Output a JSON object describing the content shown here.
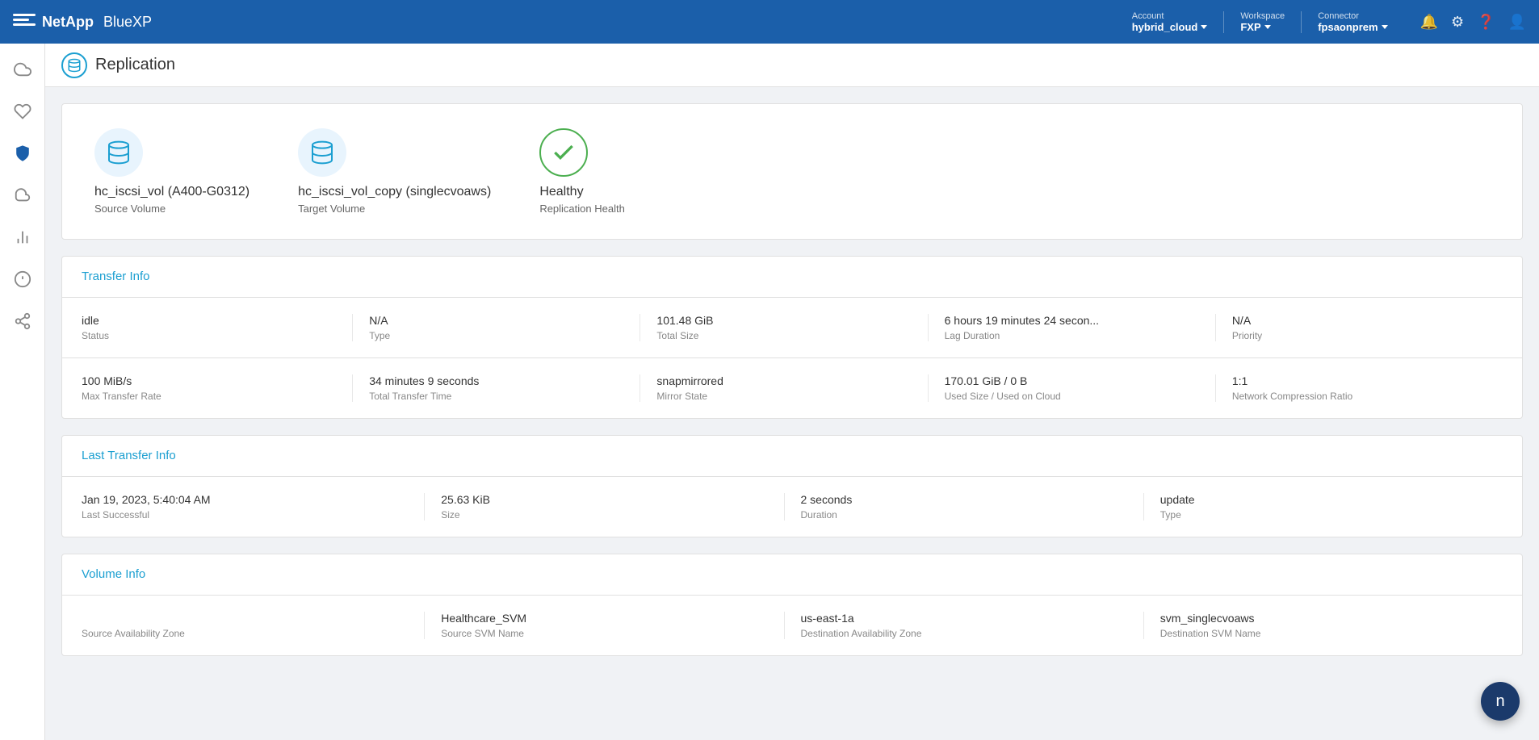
{
  "header": {
    "logo_brand": "NetApp",
    "app_name": "BlueXP",
    "account_label": "Account",
    "account_value": "hybrid_cloud",
    "workspace_label": "Workspace",
    "workspace_value": "FXP",
    "connector_label": "Connector",
    "connector_value": "fpsaonprem"
  },
  "page": {
    "title": "Replication"
  },
  "volume_info": {
    "source": {
      "name": "hc_iscsi_vol (A400-G0312)",
      "label": "Source Volume"
    },
    "target": {
      "name": "hc_iscsi_vol_copy (singlecvoaws)",
      "label": "Target Volume"
    },
    "health": {
      "status": "Healthy",
      "label": "Replication Health"
    }
  },
  "transfer_info": {
    "title": "Transfer Info",
    "rows": [
      [
        {
          "value": "idle",
          "label": "Status"
        },
        {
          "value": "N/A",
          "label": "Type"
        },
        {
          "value": "101.48 GiB",
          "label": "Total Size"
        },
        {
          "value": "6 hours 19 minutes 24 secon...",
          "label": "Lag Duration"
        },
        {
          "value": "N/A",
          "label": "Priority"
        }
      ],
      [
        {
          "value": "100 MiB/s",
          "label": "Max Transfer Rate"
        },
        {
          "value": "34 minutes 9 seconds",
          "label": "Total Transfer Time"
        },
        {
          "value": "snapmirrored",
          "label": "Mirror State"
        },
        {
          "value": "170.01 GiB / 0 B",
          "label": "Used Size / Used on Cloud"
        },
        {
          "value": "1:1",
          "label": "Network Compression Ratio"
        }
      ]
    ]
  },
  "last_transfer_info": {
    "title": "Last Transfer Info",
    "rows": [
      [
        {
          "value": "Jan 19, 2023, 5:40:04 AM",
          "label": "Last Successful"
        },
        {
          "value": "25.63 KiB",
          "label": "Size"
        },
        {
          "value": "2 seconds",
          "label": "Duration"
        },
        {
          "value": "update",
          "label": "Type"
        }
      ]
    ]
  },
  "volume_section": {
    "title": "Volume Info",
    "rows": [
      [
        {
          "value": "",
          "label": "Source Availability Zone"
        },
        {
          "value": "Healthcare_SVM",
          "label": "Source SVM Name"
        },
        {
          "value": "us-east-1a",
          "label": "Destination Availability Zone"
        },
        {
          "value": "svm_singlecvoaws",
          "label": "Destination SVM Name"
        }
      ]
    ]
  },
  "sidebar": {
    "items": [
      {
        "icon": "☁",
        "name": "cloud-icon",
        "active": false
      },
      {
        "icon": "♡",
        "name": "health-icon",
        "active": false
      },
      {
        "icon": "◆",
        "name": "shield-icon",
        "active": true
      },
      {
        "icon": "☁",
        "name": "storage-icon",
        "active": false
      },
      {
        "icon": "▤",
        "name": "chart-icon",
        "active": false
      },
      {
        "icon": "⊙",
        "name": "settings-icon",
        "active": false
      },
      {
        "icon": "⌘",
        "name": "integrations-icon",
        "active": false
      }
    ]
  },
  "floating_button": {
    "label": "n"
  }
}
